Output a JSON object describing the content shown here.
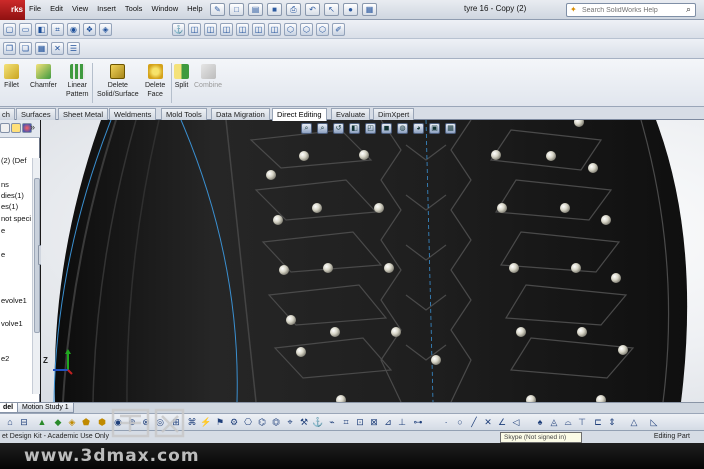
{
  "app": {
    "logo_text": "rks",
    "document_title": "tyre 16 - Copy (2)"
  },
  "menu": [
    "File",
    "Edit",
    "View",
    "Insert",
    "Tools",
    "Window",
    "Help"
  ],
  "search": {
    "placeholder": "Search SolidWorks Help"
  },
  "commands": [
    {
      "label_1": "Fillet",
      "label_2": "",
      "icon": "fillet-icon",
      "disabled": false
    },
    {
      "label_1": "Chamfer",
      "label_2": "",
      "icon": "chamfer-icon",
      "disabled": false
    },
    {
      "label_1": "Linear",
      "label_2": "Pattern",
      "icon": "linear-pattern-icon",
      "disabled": false
    },
    {
      "label_1": "Delete",
      "label_2": "Solid/Surface",
      "icon": "delete-solid-icon",
      "disabled": false
    },
    {
      "label_1": "Delete",
      "label_2": "Face",
      "icon": "delete-face-icon",
      "disabled": false
    },
    {
      "label_1": "Split",
      "label_2": "",
      "icon": "split-icon",
      "disabled": false
    },
    {
      "label_1": "Combine",
      "label_2": "",
      "icon": "combine-icon",
      "disabled": true
    }
  ],
  "tabs": [
    "ch",
    "Surfaces",
    "Sheet Metal",
    "Weldments",
    "Mold Tools",
    "Data Migration",
    "Direct Editing",
    "Evaluate",
    "DimXpert"
  ],
  "active_tab": "Direct Editing",
  "feature_tree": {
    "items": [
      "(2)  (Def",
      "ns",
      "dies(1)",
      "es(1)",
      "not speci",
      "e",
      "e",
      "evolve1",
      "volve1",
      "e2"
    ]
  },
  "triad": {
    "label": "Z"
  },
  "model_tabs": [
    "del",
    "Motion Study 1"
  ],
  "status": {
    "left": "et Design Kit - Academic Use Only",
    "right": "Editing Part",
    "tooltip": "Skype (Not signed in)"
  },
  "watermark": "www.3dmax.com",
  "colors": {
    "accent": "#2c5aa0",
    "tire": "#1c1c1c",
    "stud": "#d8d6c8",
    "sketch_line": "#3a8fd0"
  }
}
